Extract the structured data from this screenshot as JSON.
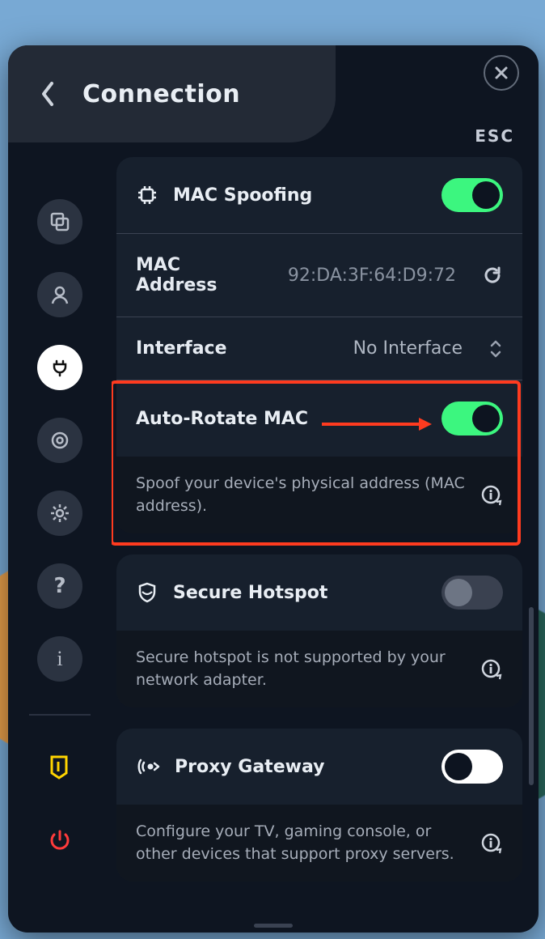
{
  "header": {
    "title": "Connection",
    "esc": "ESC"
  },
  "sidebar": {
    "items": [
      {
        "name": "windows"
      },
      {
        "name": "account"
      },
      {
        "name": "connection",
        "active": true
      },
      {
        "name": "target"
      },
      {
        "name": "settings"
      },
      {
        "name": "help"
      },
      {
        "name": "info"
      },
      {
        "name": "shield-badge"
      },
      {
        "name": "power"
      }
    ]
  },
  "mac": {
    "spoofing_label": "MAC Spoofing",
    "spoofing_on": true,
    "address_label": "MAC Address",
    "address_value": "92:DA:3F:64:D9:72",
    "interface_label": "Interface",
    "interface_value": "No Interface",
    "autorotate_label": "Auto-Rotate MAC",
    "autorotate_on": true,
    "desc": "Spoof your device's physical address (MAC address)."
  },
  "hotspot": {
    "label": "Secure Hotspot",
    "on": false,
    "desc": "Secure hotspot is not supported by your network adapter."
  },
  "proxy": {
    "label": "Proxy Gateway",
    "on": false,
    "desc": "Configure your TV, gaming console, or other devices that support proxy servers."
  }
}
